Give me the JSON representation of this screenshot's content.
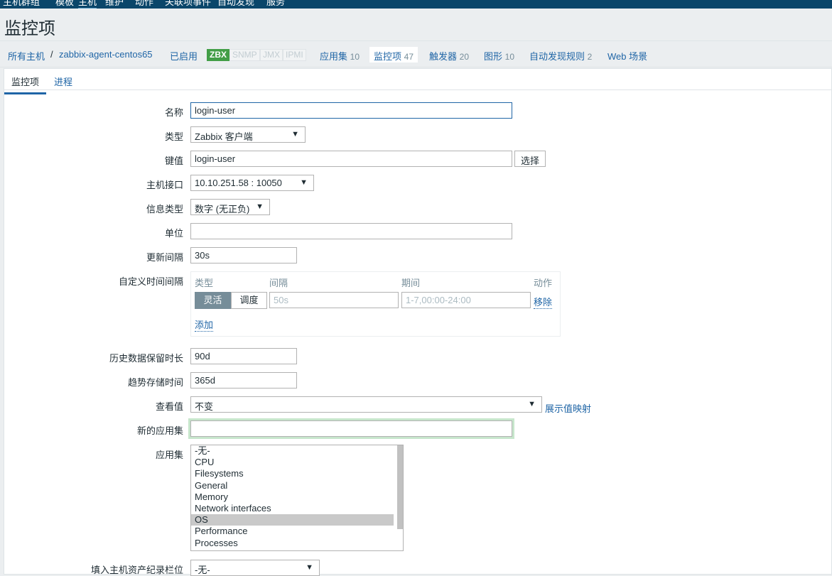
{
  "top_menu": [
    "主机群组",
    "模板",
    "主机",
    "维护",
    "动作",
    "关联项事件",
    "自动发现",
    "服务"
  ],
  "page_title": "监控项",
  "hostbar": {
    "all_hosts": "所有主机",
    "separator": "/",
    "host": "zabbix-agent-centos65",
    "status": "已启用",
    "interfaces": [
      "ZBX",
      "SNMP",
      "JMX",
      "IPMI"
    ],
    "links": [
      {
        "label": "应用集",
        "count": "10"
      },
      {
        "label": "监控项",
        "count": "47"
      },
      {
        "label": "触发器",
        "count": "20"
      },
      {
        "label": "图形",
        "count": "10"
      },
      {
        "label": "自动发现规则",
        "count": "2"
      },
      {
        "label": "Web 场景",
        "count": ""
      }
    ]
  },
  "tabs": [
    "监控项",
    "进程"
  ],
  "form": {
    "name": {
      "label": "名称",
      "value": "login-user"
    },
    "type": {
      "label": "类型",
      "value": "Zabbix 客户端"
    },
    "key": {
      "label": "键值",
      "value": "login-user",
      "button": "选择"
    },
    "interface": {
      "label": "主机接口",
      "value": "10.10.251.58 : 10050"
    },
    "info_type": {
      "label": "信息类型",
      "value": "数字 (无正负)"
    },
    "units": {
      "label": "单位",
      "value": ""
    },
    "update": {
      "label": "更新间隔",
      "value": "30s"
    },
    "custom": {
      "label": "自定义时间间隔",
      "headers": [
        "类型",
        "间隔",
        "期间",
        "动作"
      ],
      "toggle": [
        "灵活",
        "调度"
      ],
      "interval_placeholder": "50s",
      "period_placeholder": "1-7,00:00-24:00",
      "remove": "移除",
      "add": "添加"
    },
    "history": {
      "label": "历史数据保留时长",
      "value": "90d"
    },
    "trends": {
      "label": "趋势存储时间",
      "value": "365d"
    },
    "show_value": {
      "label": "查看值",
      "value": "不变",
      "link": "展示值映射"
    },
    "new_app": {
      "label": "新的应用集",
      "value": ""
    },
    "apps": {
      "label": "应用集",
      "options": [
        "-无-",
        "CPU",
        "Filesystems",
        "General",
        "Memory",
        "Network interfaces",
        "OS",
        "Performance",
        "Processes"
      ],
      "selected": "OS"
    },
    "inventory": {
      "label": "填入主机资产纪录栏位",
      "value": "-无-"
    }
  }
}
